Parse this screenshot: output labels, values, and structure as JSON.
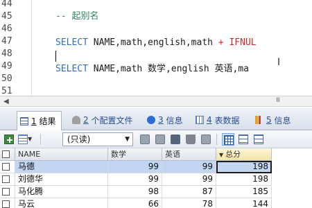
{
  "editor": {
    "line_numbers": [
      "44",
      "45",
      "46",
      "47",
      "48",
      "49",
      "50",
      "51"
    ],
    "comment_line": "-- 起别名",
    "line47": {
      "kw": "SELECT",
      "cols": " NAME,math,english,math ",
      "op": "+",
      "fn": " IFNUL"
    },
    "line49": {
      "kw": "SELECT",
      "cols": " NAME,math 数学,english 英语,ma"
    }
  },
  "scrollbar": {
    "left_arrow": "◀",
    "grip": "III"
  },
  "tabs": [
    {
      "num": "1",
      "label": "结果",
      "icon": "grid-icon"
    },
    {
      "num": "2",
      "label": "个配置文件",
      "icon": "profile-icon"
    },
    {
      "num": "3",
      "label": "信息",
      "icon": "info-icon"
    },
    {
      "num": "4",
      "label": "表数据",
      "icon": "table-icon"
    },
    {
      "num": "5",
      "label": "信息",
      "icon": "chart-icon"
    }
  ],
  "toolbar": {
    "mode_select": "(只读)",
    "dropdown_arrow": "▼",
    "split_arrow": "▼"
  },
  "grid": {
    "columns": [
      "NAME",
      "数学",
      "英语",
      "总分"
    ],
    "sorted_column": "总分",
    "sort_arrow": "▼",
    "rows": [
      {
        "name": "马德",
        "math": "99",
        "english": "99",
        "total": "198"
      },
      {
        "name": "刘德华",
        "math": "99",
        "english": "99",
        "total": "198"
      },
      {
        "name": "马化腾",
        "math": "98",
        "english": "87",
        "total": "185"
      },
      {
        "name": "马云",
        "math": "66",
        "english": "78",
        "total": "144"
      }
    ]
  },
  "colors": {
    "keyword": "#2e6fbf",
    "comment": "#2b8a5e",
    "operator": "#e02020",
    "selection": "#c2d6f2"
  }
}
